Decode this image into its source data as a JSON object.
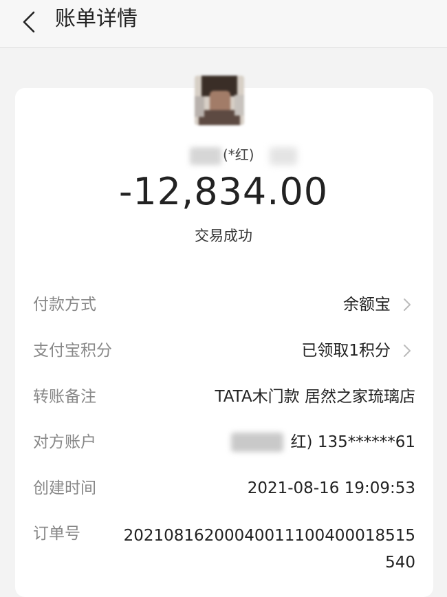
{
  "header": {
    "title": "账单详情"
  },
  "transaction": {
    "payee_name": "(*红)",
    "amount": "-12,834.00",
    "status": "交易成功"
  },
  "details": {
    "payment_method_label": "付款方式",
    "payment_method_value": "余额宝",
    "points_label": "支付宝积分",
    "points_value": "已领取1积分",
    "remark_label": "转账备注",
    "remark_value": "TATA木门款 居然之家琉璃店",
    "account_label": "对方账户",
    "account_value": "红) 135******61",
    "created_label": "创建时间",
    "created_value": "2021-08-16 19:09:53",
    "order_label": "订单号",
    "order_value": "20210816200040011100400018515540"
  },
  "colors": {
    "background": "#f3f3f3",
    "card": "#ffffff",
    "label_gray": "#888888",
    "text": "#222222"
  },
  "icons": [
    "back-arrow-icon",
    "chevron-right-icon"
  ]
}
